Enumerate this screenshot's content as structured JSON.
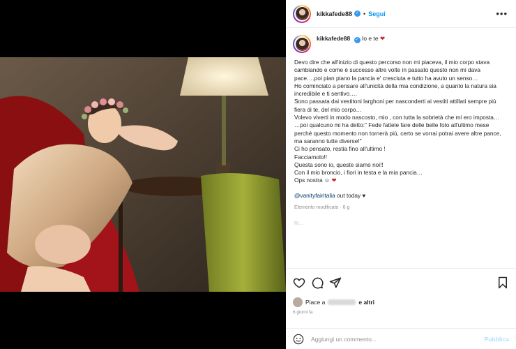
{
  "colors": {
    "accent": "#0095f6",
    "verified": "#3897f0",
    "border": "#efefef"
  },
  "header": {
    "username": "kikkafede88",
    "separator": "•",
    "follow_label": "Segui",
    "more_icon": "more-horizontal-icon"
  },
  "caption": {
    "username": "kikkafede88",
    "title_text": "Io e te",
    "paragraphs": [
      "Devo dire che all'inizio di questo percorso non mi piaceva, il mio corpo stava cambiando e come è successo altre volte in passato questo non mi dava pace….poi pian piano la pancia e' cresciuta e tutto ha avuto un senso…",
      "Ho cominciato a pensare all'unicità della mia condizione, a quanto la natura sia incredibile e ti sentivo….",
      "Sono passata dai vestitoni larghoni per nasconderti ai vestiti attillati sempre più fiera di te, del mio corpo…",
      "Volevo viverti in modo nascosto, mio , con tutta la sobrietà che mi ero imposta…",
      "…poi qualcuno mi ha detto:\" Fede fattele fare delle belle foto all'ultimo mese perché questo momento non tornerà più, certo se vorrai potrai avere altre pance, ma saranno tutte diverse!\"",
      "Ci ho pensato, restia fino all'ultimo !",
      "Facciamolo!!",
      "Questa sono io, queste siamo noi!!",
      "Con il mio broncio, i fiori in testa e la mia pancia…",
      "Ops nostra ☺"
    ],
    "mention": "@vanityfairitalia",
    "mention_suffix": " out today ♥",
    "meta": "Elemento modificato · 6 g",
    "faded_next": "Ri…"
  },
  "actions": {
    "like_icon": "heart-icon",
    "comment_icon": "comment-icon",
    "share_icon": "share-icon",
    "save_icon": "bookmark-icon"
  },
  "likes": {
    "prefix": "Piace a",
    "suffix": "e altri"
  },
  "date": "6 giorni fa",
  "comment_box": {
    "placeholder": "Aggiungi un commento...",
    "publish_label": "Pubblica",
    "emoji_icon": "emoji-icon"
  }
}
